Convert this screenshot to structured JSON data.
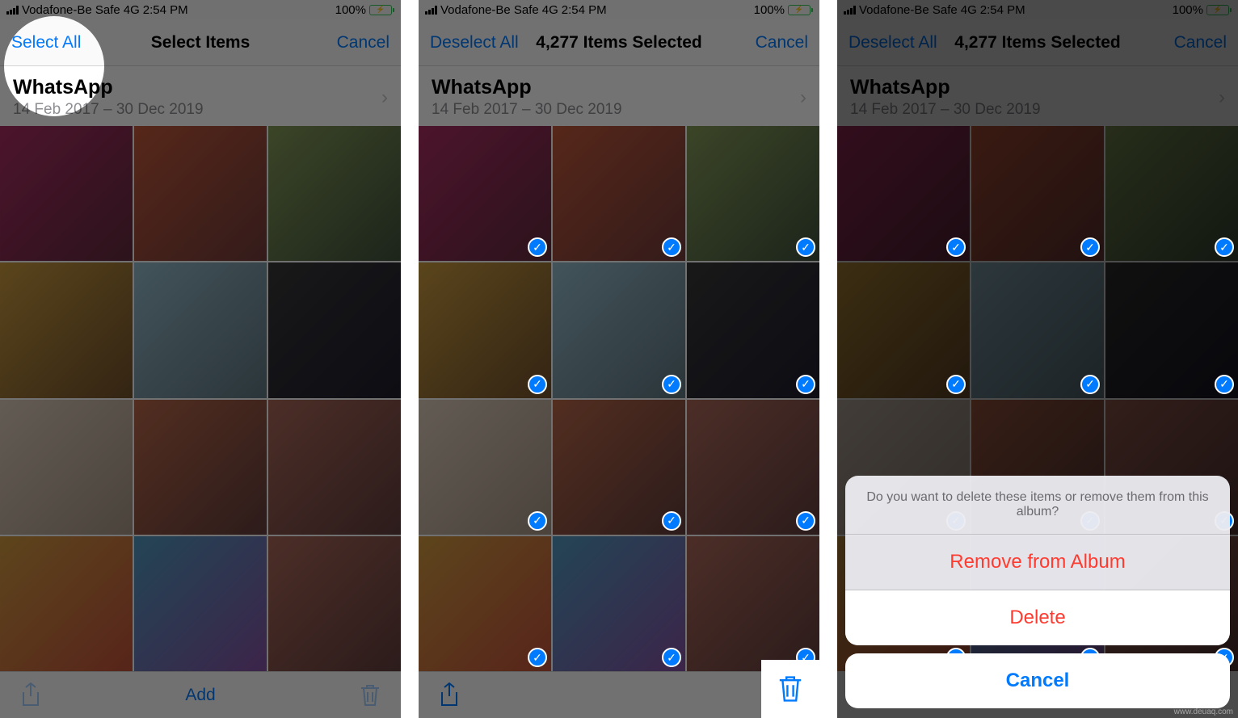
{
  "status": {
    "carrier": "Vodafone-Be Safe",
    "network": "4G",
    "time": "2:54 PM",
    "battery_pct": "100%"
  },
  "album": {
    "title": "WhatsApp",
    "date_range": "14 Feb 2017 – 30 Dec 2019"
  },
  "screens": [
    {
      "nav_left": "Select All",
      "nav_title": "Select Items",
      "nav_right": "Cancel",
      "toolbar_center": "Add"
    },
    {
      "nav_left": "Deselect All",
      "nav_title": "4,277 Items Selected",
      "nav_right": "Cancel",
      "toolbar_center": ""
    },
    {
      "nav_left": "Deselect All",
      "nav_title": "4,277 Items Selected",
      "nav_right": "Cancel",
      "toolbar_center": ""
    }
  ],
  "action_sheet": {
    "message": "Do you want to delete these items or remove them from this album?",
    "remove_label": "Remove from Album",
    "delete_label": "Delete",
    "cancel_label": "Cancel"
  },
  "watermark": "www.deuaq.com"
}
